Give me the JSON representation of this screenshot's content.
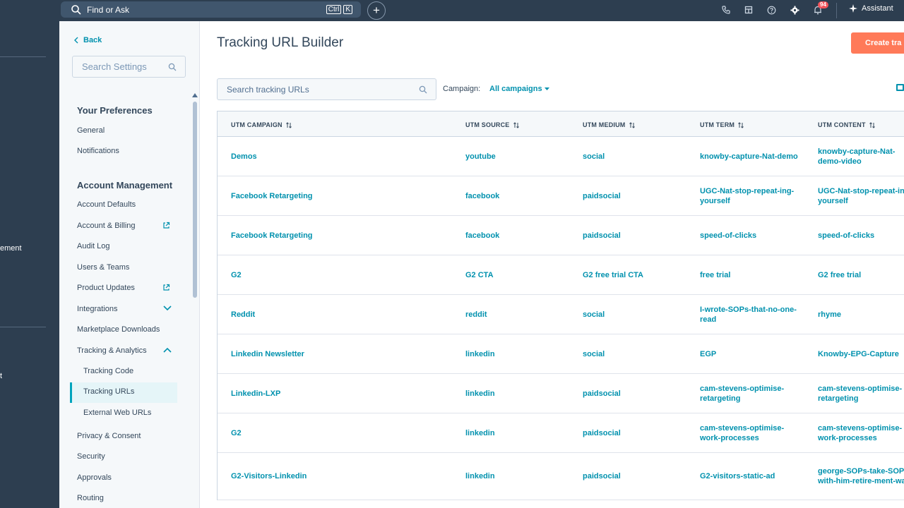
{
  "left_rail": {
    "fragment_1": "ement",
    "fragment_2": "t"
  },
  "topbar": {
    "search_label": "Find or Ask",
    "shortcut_key_1": "Ctrl",
    "shortcut_key_2": "K",
    "notification_count": "94",
    "assistant_label": "Assistant"
  },
  "sidebar": {
    "back_label": "Back",
    "search_placeholder": "Search Settings",
    "sections": [
      {
        "title": "Your Preferences",
        "items": [
          "General",
          "Notifications"
        ]
      },
      {
        "title": "Account Management",
        "items": [
          "Account Defaults",
          "Account & Billing",
          "Audit Log",
          "Users & Teams",
          "Product Updates",
          "Integrations",
          "Marketplace Downloads",
          "Tracking & Analytics",
          "Tracking Code",
          "Tracking URLs",
          "External Web URLs",
          "Privacy & Consent",
          "Security",
          "Approvals",
          "Routing"
        ]
      }
    ],
    "active_item": "Tracking URLs"
  },
  "main": {
    "title": "Tracking URL Builder",
    "create_button": "Create tra",
    "search_placeholder": "Search tracking URLs",
    "campaign_label": "Campaign:",
    "campaign_value": "All campaigns",
    "columns": [
      "UTM CAMPAIGN",
      "UTM SOURCE",
      "UTM MEDIUM",
      "UTM TERM",
      "UTM CONTENT"
    ],
    "rows": [
      [
        "Demos",
        "youtube",
        "social",
        "knowby-capture-Nat-demo",
        "knowby-capture-Nat-demo-video"
      ],
      [
        "Facebook Retargeting",
        "facebook",
        "paidsocial",
        "UGC-Nat-stop-repeat-ing-yourself",
        "UGC-Nat-stop-repeat-ing-yourself"
      ],
      [
        "Facebook Retargeting",
        "facebook",
        "paidsocial",
        "speed-of-clicks",
        "speed-of-clicks"
      ],
      [
        "G2",
        "G2 CTA",
        "G2 free trial CTA",
        "free trial",
        "G2 free trial"
      ],
      [
        "Reddit",
        "reddit",
        "social",
        "I-wrote-SOPs-that-no-one-read",
        "rhyme"
      ],
      [
        "Linkedin Newsletter",
        "linkedin",
        "social",
        "EGP",
        "Knowby-EPG-Capture"
      ],
      [
        "Linkedin-LXP",
        "linkedin",
        "paidsocial",
        "cam-stevens-optimise-retargeting",
        "cam-stevens-optimise-retargeting"
      ],
      [
        "G2",
        "linkedin",
        "paidsocial",
        "cam-stevens-optimise-work-processes",
        "cam-stevens-optimise-work-processes"
      ],
      [
        "G2-Visitors-Linkedin",
        "linkedin",
        "paidsocial",
        "G2-visitors-static-ad",
        "george-SOPs-take-SOPs-with-him-retire-ment-wave"
      ]
    ]
  },
  "colors": {
    "nav_bg": "#2d3e50",
    "accent": "#0091ae",
    "cta": "#ff7a59",
    "badge": "#f2545b"
  }
}
